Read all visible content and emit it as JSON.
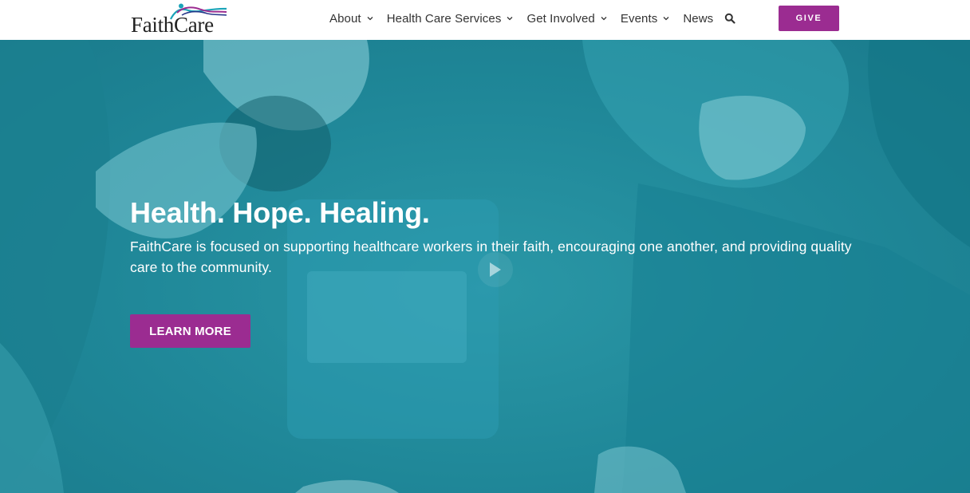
{
  "brand": {
    "name": "FaithCare",
    "logo_text_part1": "Faith",
    "logo_text_part2": "Care"
  },
  "nav": {
    "items": [
      {
        "label": "About",
        "has_dropdown": true
      },
      {
        "label": "Health Care Services",
        "has_dropdown": true
      },
      {
        "label": "Get Involved",
        "has_dropdown": true
      },
      {
        "label": "Events",
        "has_dropdown": true
      },
      {
        "label": "News",
        "has_dropdown": false
      }
    ],
    "search_icon": "search-icon",
    "give_label": "GIVE"
  },
  "hero": {
    "title": "Health. Hope. Healing.",
    "text": "FaithCare is focused on supporting healthcare workers in their faith, encouraging one another, and providing quality care to the community.",
    "cta_label": "LEARN MORE",
    "play_icon": "play-icon"
  },
  "colors": {
    "accent": "#9b2c91",
    "hero_overlay": "#1f8a9a",
    "header_bg": "#ffffff",
    "nav_text": "#333333"
  }
}
